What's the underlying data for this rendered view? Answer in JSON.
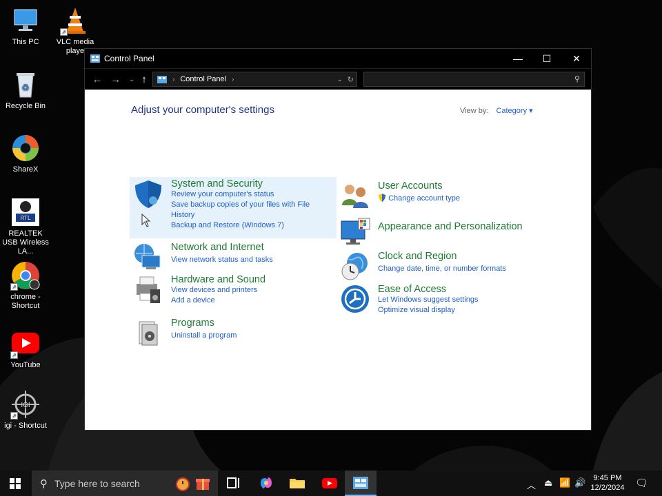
{
  "desktop": {
    "icons": [
      {
        "label": "This PC",
        "icon": "this-pc-icon"
      },
      {
        "label": "VLC media playe",
        "icon": "vlc-icon"
      },
      {
        "label": "Recycle Bin",
        "icon": "recycle-bin-icon"
      },
      {
        "label": "ShareX",
        "icon": "sharex-icon"
      },
      {
        "label": "REALTEK USB Wireless LA...",
        "icon": "realtek-icon"
      },
      {
        "label": "chrome - Shortcut",
        "icon": "chrome-icon"
      },
      {
        "label": "YouTube",
        "icon": "youtube-icon"
      },
      {
        "label": "igi - Shortcut",
        "icon": "igi-icon"
      }
    ]
  },
  "window": {
    "title": "Control Panel",
    "address": {
      "segment": "Control Panel"
    },
    "heading": "Adjust your computer's settings",
    "view_by": {
      "label": "View by:",
      "value": "Category"
    },
    "categories": {
      "system_security": {
        "title": "System and Security",
        "links": [
          "Review your computer's status",
          "Save backup copies of your files with File",
          "History",
          "Backup and Restore (Windows 7)"
        ]
      },
      "network_internet": {
        "title": "Network and Internet",
        "links": [
          "View network status and tasks"
        ]
      },
      "hardware_sound": {
        "title": "Hardware and Sound",
        "links": [
          "View devices and printers",
          "Add a device"
        ]
      },
      "programs": {
        "title": "Programs",
        "links": [
          "Uninstall a program"
        ]
      },
      "user_accounts": {
        "title": "User Accounts",
        "links": [
          "Change account type"
        ]
      },
      "appearance": {
        "title": "Appearance and Personalization",
        "links": []
      },
      "clock_region": {
        "title": "Clock and Region",
        "links": [
          "Change date, time, or number formats"
        ]
      },
      "ease_access": {
        "title": "Ease of Access",
        "links": [
          "Let Windows suggest settings",
          "Optimize visual display"
        ]
      }
    }
  },
  "taskbar": {
    "search_placeholder": "Type here to search",
    "time": "9:45 PM",
    "date": "12/2/2024"
  },
  "colors": {
    "link": "#1f5ecc",
    "category_title": "#1e7b34",
    "heading": "#1e3287",
    "hover_highlight": "#e5f1fb"
  }
}
